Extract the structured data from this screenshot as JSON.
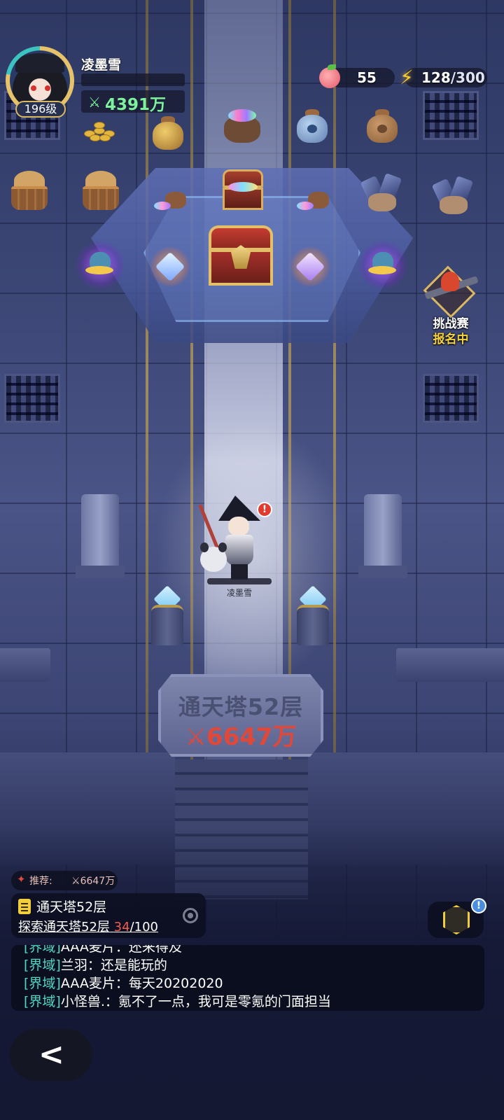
{
  "player": {
    "name": "凌墨雪",
    "level": "196级",
    "power_icon": "power-icon",
    "power": "4391万"
  },
  "resources": {
    "peach_icon": "peach-icon",
    "peach_count": "55",
    "energy_icon": "lightning-bolt-icon",
    "energy_current": "128",
    "energy_max": "/300"
  },
  "challenge": {
    "title": "挑战赛",
    "status": "报名中"
  },
  "hero": {
    "name": "凌墨雪",
    "alert": "!"
  },
  "floor": {
    "title": "通天塔52层",
    "required_power": "6647万"
  },
  "recommend": {
    "label": "推荐:",
    "value": "6647万"
  },
  "task": {
    "title": "通天塔52层",
    "desc": "探索通天塔52层 ",
    "progress": "34",
    "total": "/100"
  },
  "cube_badge": "!",
  "chat": {
    "cut_channel": "[界域]",
    "cut_text": "AAA麦片：还来得及",
    "lines": [
      {
        "channel": "[界域]",
        "sender": "兰羽",
        "text": "：还是能玩的"
      },
      {
        "channel": "[界域]",
        "sender": "AAA麦片",
        "text": "：每天20202020"
      },
      {
        "channel": "[界域]",
        "sender": "小怪兽.",
        "text": "：氪不了一点，我可是零氪的门面担当"
      }
    ]
  },
  "back_glyph": "<",
  "colors": {
    "power_green": "#7cf29c",
    "required_red": "#e0483a",
    "chat_channel": "#4fd6c5",
    "challenge_status": "#f6d23c",
    "progress_red": "#f05c4f"
  }
}
